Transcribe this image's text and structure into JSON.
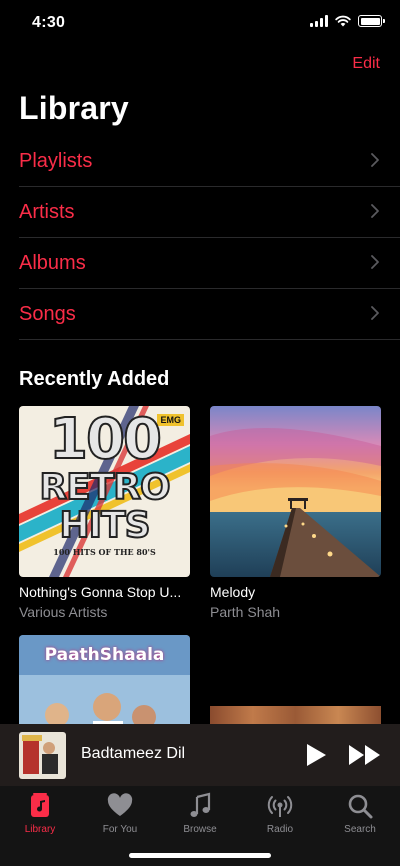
{
  "status": {
    "time": "4:30"
  },
  "header": {
    "edit_label": "Edit",
    "title": "Library"
  },
  "nav": [
    {
      "label": "Playlists"
    },
    {
      "label": "Artists"
    },
    {
      "label": "Albums"
    },
    {
      "label": "Songs"
    }
  ],
  "recent": {
    "title": "Recently Added",
    "albums": [
      {
        "title": "Nothing's Gonna Stop U...",
        "artist": "Various Artists",
        "art_text": [
          "100",
          "RETRO",
          "HITS"
        ],
        "art_subtitle": "100 HITS OF THE 80'S",
        "art_badge": "EMG"
      },
      {
        "title": "Melody",
        "artist": "Parth Shah"
      },
      {
        "title": "",
        "artist": "",
        "art_text": [
          "PaathShaala"
        ]
      },
      {
        "title": "",
        "artist": ""
      }
    ]
  },
  "now_playing": {
    "title": "Badtameez Dil"
  },
  "tabs": [
    {
      "label": "Library",
      "icon": "library-icon",
      "active": true
    },
    {
      "label": "For You",
      "icon": "heart-icon"
    },
    {
      "label": "Browse",
      "icon": "music-note-icon"
    },
    {
      "label": "Radio",
      "icon": "radio-icon"
    },
    {
      "label": "Search",
      "icon": "search-icon"
    }
  ],
  "colors": {
    "accent": "#fa2d48",
    "background": "#000000",
    "secondary_text": "#8e8e93",
    "mini_player": "#221d1c"
  }
}
